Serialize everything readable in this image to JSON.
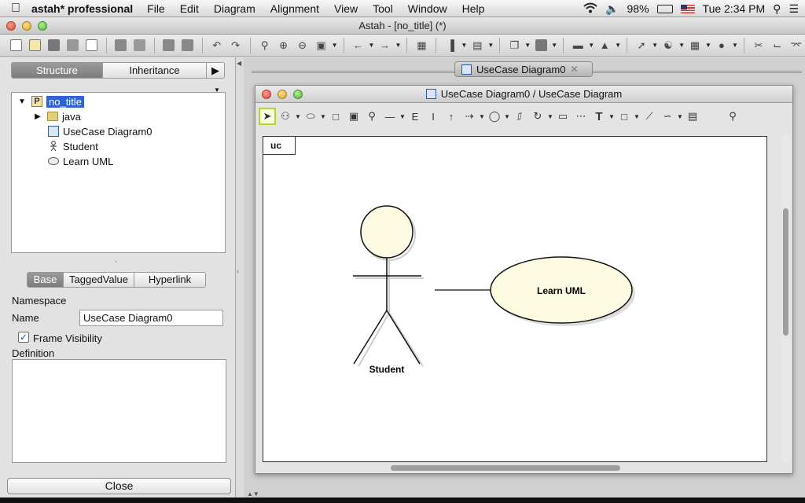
{
  "menubar": {
    "app_name": "astah* professional",
    "items": [
      "File",
      "Edit",
      "Diagram",
      "Alignment",
      "View",
      "Tool",
      "Window",
      "Help"
    ],
    "battery": "98%",
    "clock": "Tue 2:34 PM"
  },
  "window": {
    "title": "Astah - [no_title] (*)"
  },
  "left": {
    "tabs": [
      "Structure",
      "Inheritance"
    ],
    "active_tab": "Structure",
    "tree": {
      "root": "no_title",
      "children": [
        "java",
        "UseCase Diagram0",
        "Student",
        "Learn UML"
      ]
    },
    "prop_tabs": [
      "Base",
      "TaggedValue",
      "Hyperlink"
    ],
    "active_prop_tab": "Base",
    "namespace_label": "Namespace",
    "name_label": "Name",
    "name_value": "UseCase Diagram0",
    "frame_visibility_label": "Frame Visibility",
    "frame_visibility_checked": true,
    "definition_label": "Definition",
    "close_label": "Close"
  },
  "editor": {
    "doc_tab": "UseCase Diagram0",
    "inner_title": "UseCase Diagram0 / UseCase Diagram",
    "frame_label": "uc",
    "actor_name": "Student",
    "usecase_name": "Learn UML"
  },
  "colors": {
    "selection": "#2f63d3",
    "element_fill": "#fdfce3",
    "active_tab": "#8a8a8a"
  }
}
